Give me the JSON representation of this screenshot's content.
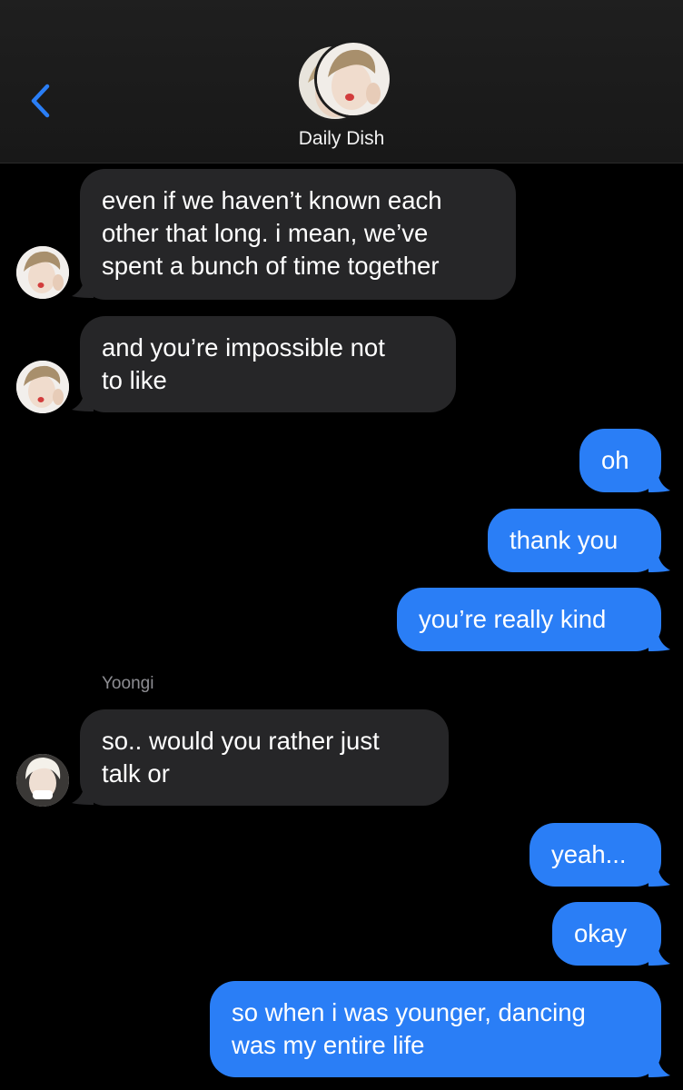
{
  "header": {
    "title": "Daily Dish"
  },
  "colors": {
    "incoming_bubble": "#262628",
    "outgoing_bubble": "#2a7ef6",
    "back_chevron": "#2a7ef6",
    "background": "#000000"
  },
  "messages": [
    {
      "direction": "incoming",
      "lines": [
        "even if we haven’t known each",
        "other that long. i mean, we’ve",
        "spent a bunch of time together"
      ]
    },
    {
      "direction": "incoming",
      "lines": [
        "and you’re impossible not",
        "to like"
      ]
    },
    {
      "direction": "outgoing",
      "lines": [
        "oh"
      ]
    },
    {
      "direction": "outgoing",
      "lines": [
        "thank you"
      ]
    },
    {
      "direction": "outgoing",
      "lines": [
        "you’re really kind"
      ]
    },
    {
      "direction": "incoming",
      "sender": "Yoongi",
      "lines": [
        "so.. would you rather just",
        "talk or"
      ]
    },
    {
      "direction": "outgoing",
      "lines": [
        "yeah..."
      ]
    },
    {
      "direction": "outgoing",
      "lines": [
        "okay"
      ]
    },
    {
      "direction": "outgoing",
      "lines": [
        "so when i was younger, dancing",
        "was my entire life"
      ]
    }
  ],
  "icons": {
    "back": "chevron-left-icon"
  }
}
